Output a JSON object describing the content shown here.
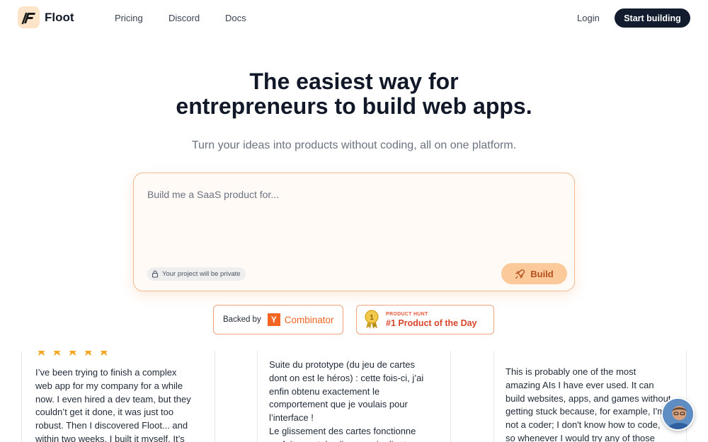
{
  "header": {
    "brand": "Floot",
    "nav": [
      "Pricing",
      "Discord",
      "Docs"
    ],
    "login": "Login",
    "cta": "Start building"
  },
  "hero": {
    "title_line1": "The easiest way for",
    "title_line2": "entrepreneurs to build web apps.",
    "subtitle": "Turn your ideas into products without coding, all on one platform."
  },
  "prompt": {
    "placeholder": "Build me a SaaS product for...",
    "private_note": "Your project will be private",
    "build_label": "Build"
  },
  "badges": {
    "backed_by": "Backed by",
    "yc_letter": "Y",
    "yc_name": "Combinator",
    "ph_small": "PRODUCT HUNT",
    "ph_title": "#1 Product of the Day",
    "medal_number": "1"
  },
  "testimonials": [
    {
      "stars": 5,
      "text": "I’ve been trying to finish a complex\nweb app for my company for a while\nnow. I even hired a dev team, but they\ncouldn’t get it done, it was just too\nrobust. Then I discovered Floot... and\nwithin two weeks, I built it myself. It’s"
    },
    {
      "text": "Suite du prototype (du jeu de cartes\ndont on est le héros) : cette fois-ci, j’ai\nenfin obtenu exactement le\ncomportement que je voulais pour\nl’interface !\nLe glissement des cartes fonctionne\nparfaitement, les lignes qui relient"
    },
    {
      "text": "This is probably one of the most\namazing AIs I have ever used. It can\nbuild websites, apps, and games without\ngetting stuck because, for example, I'm\nnot a coder; I don't know how to code,\nso whenever I would try any of those"
    }
  ],
  "colors": {
    "accent": "#f3b98c",
    "build_button": "#fcc99a",
    "cta_dark": "#131b2e",
    "yc_orange": "#f26522",
    "ph_red": "#d9452b",
    "star": "#f4a623"
  }
}
